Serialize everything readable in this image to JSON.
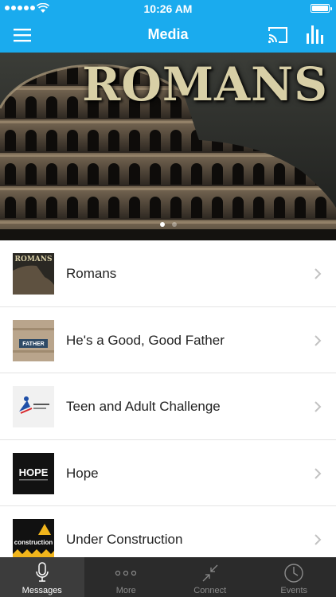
{
  "status_bar": {
    "time": "10:26 AM"
  },
  "nav": {
    "title": "Media"
  },
  "hero": {
    "title": "ROMANS",
    "page_count": 2,
    "active_page": 1
  },
  "media_list": [
    {
      "label": "Romans",
      "thumb_text": "ROMANS"
    },
    {
      "label": "He's a Good, Good Father",
      "thumb_text": "FATHER"
    },
    {
      "label": "Teen and Adult Challenge",
      "thumb_text": ""
    },
    {
      "label": "Hope",
      "thumb_text": "HOPE"
    },
    {
      "label": "Under Construction",
      "thumb_text": "construction"
    }
  ],
  "tabs": [
    {
      "label": "Messages",
      "icon": "microphone-icon",
      "active": true
    },
    {
      "label": "More",
      "icon": "more-dots-icon",
      "active": false
    },
    {
      "label": "Connect",
      "icon": "connect-arrows-icon",
      "active": false
    },
    {
      "label": "Events",
      "icon": "clock-icon",
      "active": false
    }
  ],
  "colors": {
    "primary": "#1aabee",
    "tab_bar": "#2b2b2b"
  }
}
